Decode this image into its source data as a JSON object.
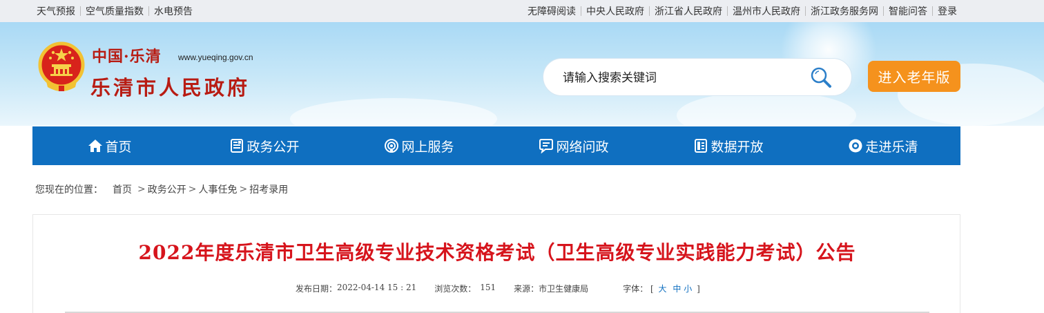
{
  "topbar": {
    "left_links": [
      "天气预报",
      "空气质量指数",
      "水电预告"
    ],
    "right_links": [
      "无障碍阅读",
      "中央人民政府",
      "浙江省人民政府",
      "温州市人民政府",
      "浙江政务服务网",
      "智能问答",
      "登录"
    ]
  },
  "header": {
    "logo_top": "中国·乐清",
    "logo_url": "www.yueqing.gov.cn",
    "logo_name": "乐清市人民政府",
    "search_placeholder": "请输入搜索关键词",
    "elder_button": "进入老年版"
  },
  "nav": {
    "items": [
      {
        "label": "首页",
        "icon": "home-icon"
      },
      {
        "label": "政务公开",
        "icon": "document-icon"
      },
      {
        "label": "网上服务",
        "icon": "service-icon"
      },
      {
        "label": "网络问政",
        "icon": "chat-icon"
      },
      {
        "label": "数据开放",
        "icon": "data-icon"
      },
      {
        "label": "走进乐清",
        "icon": "eye-icon"
      }
    ]
  },
  "breadcrumb": {
    "label": "您现在的位置：",
    "items": [
      "首页",
      "政务公开",
      "人事任免",
      "招考录用"
    ]
  },
  "article": {
    "title": "2022年度乐清市卫生高级专业技术资格考试（卫生高级专业实践能力考试）公告",
    "publish_label": "发布日期：",
    "publish_date": "2022-04-14 15 : 21",
    "views_label": "浏览次数：",
    "views": "151",
    "source_label": "来源：",
    "source": "市卫生健康局",
    "fontsize_label": "字体：",
    "fontsize_open": "[",
    "fontsize_large": "大",
    "fontsize_medium": "中",
    "fontsize_small": "小",
    "fontsize_close": "]"
  },
  "colors": {
    "nav_bg": "#0f6fc0",
    "elder_button": "#f5921d",
    "title_red": "#d6141c",
    "logo_red": "#b81c13"
  }
}
